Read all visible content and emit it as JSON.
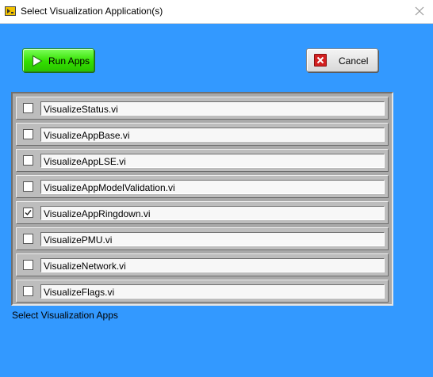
{
  "window": {
    "title": "Select Visualization Application(s)",
    "icon": "labview-app-icon",
    "background_color": "#3399ff"
  },
  "toolbar": {
    "run_label": "Run Apps",
    "run_icon": "play-icon",
    "run_color": "#33e000",
    "cancel_label": "Cancel",
    "cancel_icon": "close-x-icon",
    "cancel_icon_color": "#d21f1f"
  },
  "list": {
    "caption": "Select Visualization Apps",
    "items": [
      {
        "label": "VisualizeStatus.vi",
        "checked": false
      },
      {
        "label": "VisualizeAppBase.vi",
        "checked": false
      },
      {
        "label": "VisualizeAppLSE.vi",
        "checked": false
      },
      {
        "label": "VisualizeAppModelValidation.vi",
        "checked": false
      },
      {
        "label": "VisualizeAppRingdown.vi",
        "checked": true
      },
      {
        "label": "VisualizePMU.vi",
        "checked": false
      },
      {
        "label": "VisualizeNetwork.vi",
        "checked": false
      },
      {
        "label": "VisualizeFlags.vi",
        "checked": false
      }
    ]
  }
}
